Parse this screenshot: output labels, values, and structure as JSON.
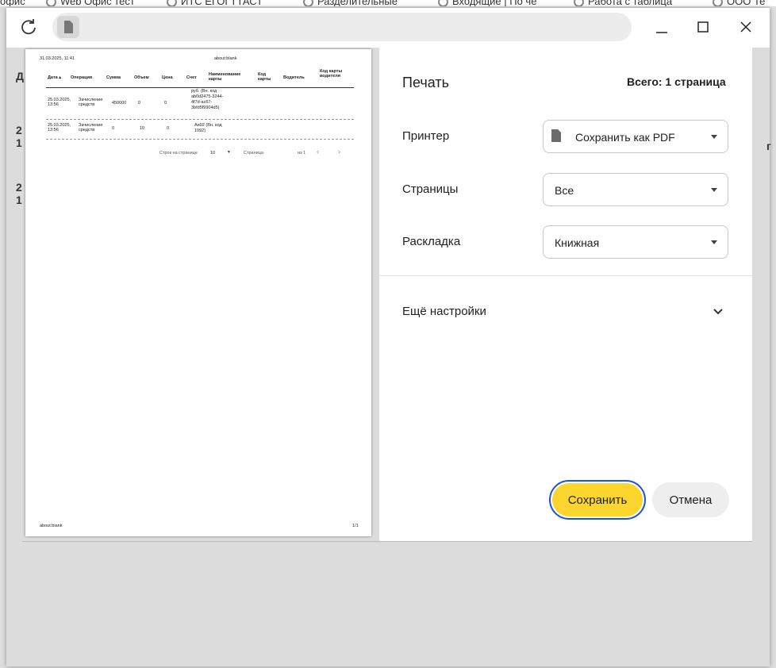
{
  "bookmarks": [
    "офис",
    "Web Офис тест",
    "ИТС ЕГОГТТАСТ",
    "Разделительные",
    "Входящие | По че",
    "Работа с таблица",
    "ООО Те"
  ],
  "toolbar": {
    "reload_icon": "reload-icon",
    "page_icon": "document-icon"
  },
  "window": {
    "minimize": "—",
    "maximize": "☐",
    "close": "✕"
  },
  "background": {
    "frag1": "Д",
    "frag2": "2",
    "frag3": "1",
    "frag4": "2",
    "frag5": "1",
    "frag6": "г"
  },
  "preview": {
    "header_left": "31.03.2025, 11:41",
    "header_center": "about:blank",
    "columns": [
      "Дата",
      "Операция",
      "Сумма",
      "Объем",
      "Цена",
      "Счет",
      "Наименование карты",
      "Код карты",
      "Водитель",
      "Код карты водителя"
    ],
    "rows": [
      {
        "date": "25.03.2025, 13:56",
        "operation": "Зачисление средств",
        "sum": "450000",
        "volume": "0",
        "price": "0",
        "account": "руб. (Вн. код ab0d2475-3244-4f7d-ac67-3bfd5f9904d5)"
      },
      {
        "date": "25.03.2025, 13:56",
        "operation": "Зачисление средств",
        "sum": "0",
        "volume": "10",
        "price": "0",
        "account": "Аи92 (Вн. код 1092)"
      }
    ],
    "pagination": {
      "rows_label": "Строк на странице",
      "rows_value": "10",
      "page_label": "Страница",
      "of_label": "из 1"
    },
    "footer_left": "about:blank",
    "footer_right": "1/1"
  },
  "panel": {
    "title": "Печать",
    "total": "Всего: 1 страница",
    "printer_label": "Принтер",
    "printer_value": "Сохранить как PDF",
    "pages_label": "Страницы",
    "pages_value": "Все",
    "layout_label": "Раскладка",
    "layout_value": "Книжная",
    "more_settings": "Ещё настройки",
    "save_button": "Сохранить",
    "cancel_button": "Отмена"
  }
}
